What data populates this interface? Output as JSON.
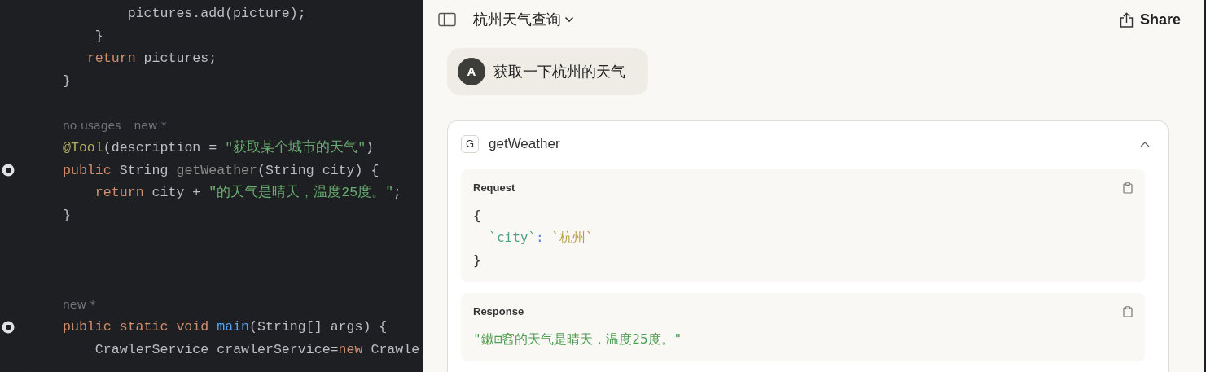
{
  "editor": {
    "lines": [
      {
        "kind": "code",
        "marker": false,
        "tokens": [
          {
            "t": "        pictures.add(picture);",
            "kind": "plain"
          }
        ]
      },
      {
        "kind": "code",
        "marker": false,
        "tokens": [
          {
            "t": "    }",
            "kind": "plain"
          }
        ]
      },
      {
        "kind": "code",
        "marker": false,
        "tokens": [
          {
            "t": "   return",
            "kind": "kw"
          },
          {
            "t": " pictures;",
            "kind": "plain"
          }
        ]
      },
      {
        "kind": "code",
        "marker": false,
        "tokens": [
          {
            "t": "}",
            "kind": "plain"
          }
        ]
      },
      {
        "kind": "blank"
      },
      {
        "kind": "hint",
        "hints": [
          "no usages",
          "new *"
        ]
      },
      {
        "kind": "code",
        "marker": false,
        "tokens": [
          {
            "t": "@Tool",
            "kind": "ann"
          },
          {
            "t": "(description = ",
            "kind": "plain"
          },
          {
            "t": "\"获取某个城市的天气\"",
            "kind": "str"
          },
          {
            "t": ")",
            "kind": "plain"
          }
        ]
      },
      {
        "kind": "code",
        "marker": true,
        "tokens": [
          {
            "t": "public",
            "kind": "kw"
          },
          {
            "t": " String ",
            "kind": "plain"
          },
          {
            "t": "getWeather",
            "kind": "unused"
          },
          {
            "t": "(String city) {",
            "kind": "plain"
          }
        ]
      },
      {
        "kind": "code",
        "marker": false,
        "tokens": [
          {
            "t": "    return",
            "kind": "kw"
          },
          {
            "t": " city + ",
            "kind": "plain"
          },
          {
            "t": "\"的天气是晴天，温度25度。\"",
            "kind": "str"
          },
          {
            "t": ";",
            "kind": "plain"
          }
        ]
      },
      {
        "kind": "code",
        "marker": false,
        "tokens": [
          {
            "t": "}",
            "kind": "plain"
          }
        ]
      },
      {
        "kind": "blank"
      },
      {
        "kind": "blank"
      },
      {
        "kind": "blank"
      },
      {
        "kind": "hint",
        "hints": [
          "new *"
        ]
      },
      {
        "kind": "code",
        "marker": true,
        "tokens": [
          {
            "t": "public static void ",
            "kind": "kw"
          },
          {
            "t": "main",
            "kind": "fn"
          },
          {
            "t": "(String[] args) {",
            "kind": "plain"
          }
        ]
      },
      {
        "kind": "code",
        "marker": false,
        "tokens": [
          {
            "t": "    CrawlerService crawlerService=",
            "kind": "plain"
          },
          {
            "t": "new",
            "kind": "kw"
          },
          {
            "t": " Crawle",
            "kind": "plain"
          }
        ]
      }
    ]
  },
  "chat": {
    "title": "杭州天气查询",
    "share": "Share",
    "user_message": {
      "avatar": "A",
      "text": "获取一下杭州的天气"
    },
    "tool_call": {
      "badge": "G",
      "name": "getWeather",
      "expanded": true,
      "sections": [
        {
          "label": "Request",
          "lines": [
            [
              {
                "t": "{",
                "kind": "plain"
              }
            ],
            [
              {
                "t": "  `city`",
                "kind": "key"
              },
              {
                "t": ": ",
                "kind": "punct"
              },
              {
                "t": "`杭州`",
                "kind": "val"
              }
            ],
            [
              {
                "t": "}",
                "kind": "plain"
              }
            ]
          ]
        },
        {
          "label": "Response",
          "lines": [
            [
              {
                "t": "\"鏉⊡窞的天气是晴天，温度25度。\"",
                "kind": "str"
              }
            ]
          ]
        }
      ]
    }
  }
}
